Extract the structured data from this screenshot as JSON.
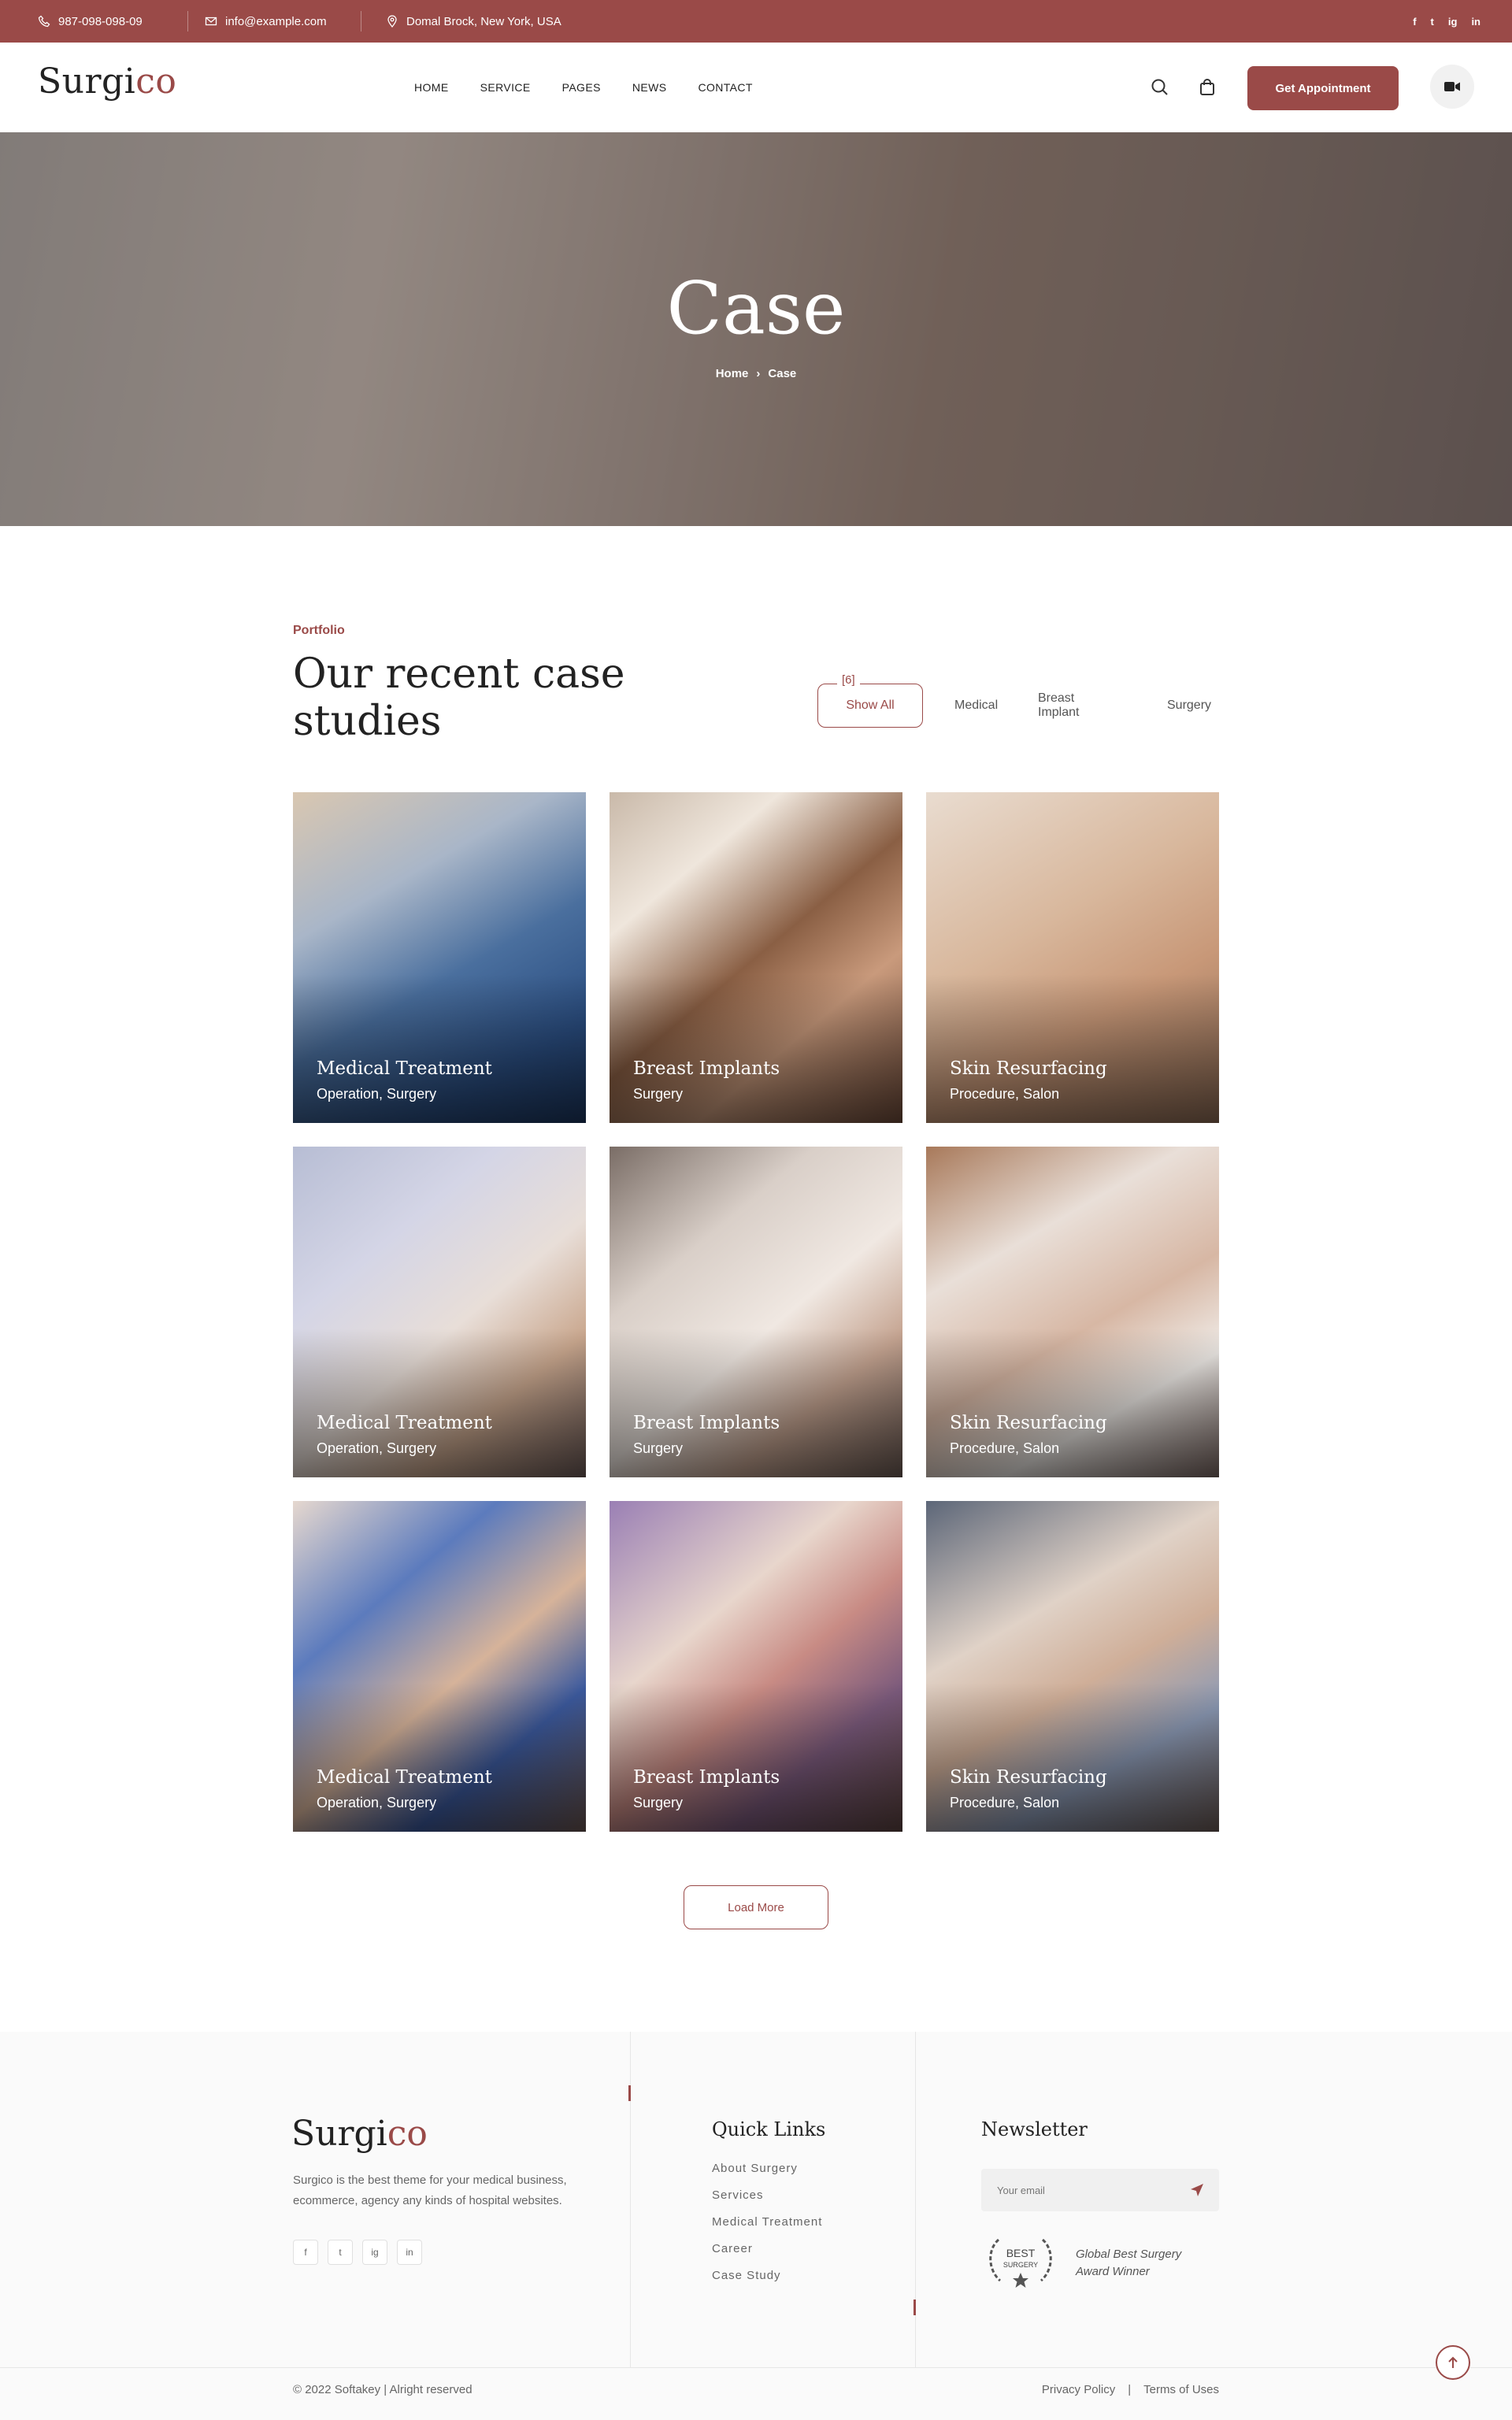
{
  "topbar": {
    "phone": "987-098-098-09",
    "email": "info@example.com",
    "address": "Domal Brock, New York, USA",
    "social": [
      "f",
      "t",
      "ig",
      "in"
    ]
  },
  "header": {
    "logo_main": "Surgi",
    "logo_accent": "co",
    "nav": [
      "HOME",
      "SERVICE",
      "PAGES",
      "NEWS",
      "CONTACT"
    ],
    "appointment_label": "Get Appointment"
  },
  "hero": {
    "title": "Case",
    "breadcrumb_home": "Home",
    "breadcrumb_current": "Case"
  },
  "portfolio": {
    "eyebrow": "Portfolio",
    "title": "Our recent case studies",
    "filter_count": "[6]",
    "filters": [
      "Show All",
      "Medical",
      "Breast Implant",
      "Surgery"
    ],
    "cards": [
      {
        "title": "Medical Treatment",
        "tags": "Operation, Surgery"
      },
      {
        "title": "Breast Implants",
        "tags": "Surgery"
      },
      {
        "title": "Skin Resurfacing",
        "tags": "Procedure, Salon"
      },
      {
        "title": "Medical Treatment",
        "tags": "Operation, Surgery"
      },
      {
        "title": "Breast Implants",
        "tags": "Surgery"
      },
      {
        "title": "Skin Resurfacing",
        "tags": "Procedure, Salon"
      },
      {
        "title": "Medical Treatment",
        "tags": "Operation, Surgery"
      },
      {
        "title": "Breast Implants",
        "tags": "Surgery"
      },
      {
        "title": "Skin Resurfacing",
        "tags": "Procedure, Salon"
      }
    ],
    "load_more": "Load More"
  },
  "footer": {
    "logo_main": "Surgi",
    "logo_accent": "co",
    "description": "Surgico is the best theme for your medical business, ecommerce, agency any kinds of hospital websites.",
    "social": [
      "f",
      "t",
      "ig",
      "in"
    ],
    "quick_links_title": "Quick Links",
    "quick_links": [
      "About Surgery",
      "Services",
      "Medical Treatment",
      "Career",
      "Case Study"
    ],
    "newsletter_title": "Newsletter",
    "newsletter_placeholder": "Your email",
    "badge_line1": "BEST",
    "badge_line2": "SURGERY",
    "award_line1": "Global Best Surgery",
    "award_line2": "Award Winner",
    "copyright": "© 2022 Softakey | Alright reserved",
    "privacy": "Privacy Policy",
    "divider": "|",
    "terms": "Terms of Uses"
  },
  "colors": {
    "accent": "#9a4a48",
    "text": "#222222",
    "muted": "#666666"
  }
}
